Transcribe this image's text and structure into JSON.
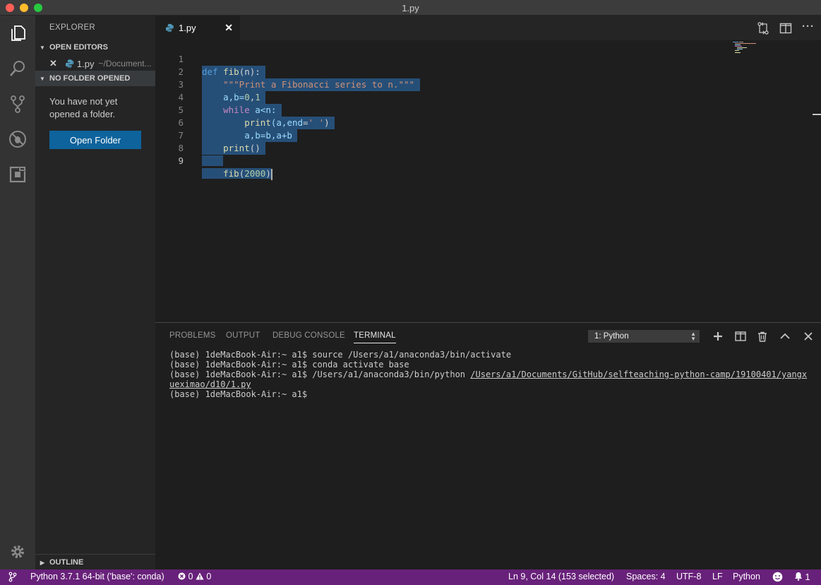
{
  "window": {
    "title": "1.py"
  },
  "colors": {
    "statusbar": "#68217a",
    "button": "#0e639c",
    "selection": "#264f78",
    "keyword": "#569cd6",
    "string": "#ce9178",
    "number": "#b5cea8"
  },
  "activity": {
    "icons": [
      "files-icon",
      "search-icon",
      "source-control-icon",
      "debug-icon",
      "extensions-icon",
      "settings-gear-icon"
    ]
  },
  "sidebar": {
    "title": "EXPLORER",
    "open_editors_label": "OPEN EDITORS",
    "open_editor_item": {
      "close": "✕",
      "name": "1.py",
      "path": "~/Document..."
    },
    "no_folder_label": "NO FOLDER OPENED",
    "no_folder_message": "You have not yet opened a folder.",
    "open_folder_button": "Open Folder",
    "outline_label": "OUTLINE"
  },
  "tabs": [
    {
      "name": "1.py",
      "close": "✕"
    }
  ],
  "editor": {
    "lines": [
      {
        "n": "1"
      },
      {
        "n": "2"
      },
      {
        "n": "3"
      },
      {
        "n": "4"
      },
      {
        "n": "5"
      },
      {
        "n": "6"
      },
      {
        "n": "7"
      },
      {
        "n": "8"
      },
      {
        "n": "9"
      }
    ],
    "tokens": {
      "l1_def": "def",
      "l1_fib": "fib",
      "l1_rest": "(n):",
      "l2_doc": "\"\"\"Print a Fibonacci series to n.\"\"\"",
      "l3_a": "a,b=",
      "l3_0": "0",
      "l3_c": ",",
      "l3_1": "1",
      "l4_while": "while",
      "l4_rest": " a<n:",
      "l5_print": "print",
      "l5_open": "(a,",
      "l5_end": "end",
      "l5_eq": "=",
      "l5_str": "' '",
      "l5_close": ")",
      "l6": "a,b=b,a+b",
      "l7_print": "print",
      "l7_rest": "()",
      "l9_fib": "fib",
      "l9_open": "(",
      "l9_num": "2000",
      "l9_close": ")"
    }
  },
  "panel": {
    "tabs": [
      "PROBLEMS",
      "OUTPUT",
      "DEBUG CONSOLE",
      "TERMINAL"
    ],
    "terminal_select": "1: Python",
    "terminal_lines": {
      "l1": "(base) 1deMacBook-Air:~ a1$ source /Users/a1/anaconda3/bin/activate",
      "l2": "(base) 1deMacBook-Air:~ a1$ conda activate base",
      "l3_prefix": "(base) 1deMacBook-Air:~ a1$ /Users/a1/anaconda3/bin/python ",
      "l3_link": "/Users/a1/Documents/GitHub/selfteaching-python-camp/19100401/yangxueximao/d10/1.py",
      "l4": "(base) 1deMacBook-Air:~ a1$"
    }
  },
  "status": {
    "interpreter": "Python 3.7.1 64-bit ('base': conda)",
    "errors": "0",
    "warnings": "0",
    "position": "Ln 9, Col 14 (153 selected)",
    "spaces": "Spaces: 4",
    "encoding": "UTF-8",
    "eol": "LF",
    "language": "Python",
    "notifications": "1"
  }
}
